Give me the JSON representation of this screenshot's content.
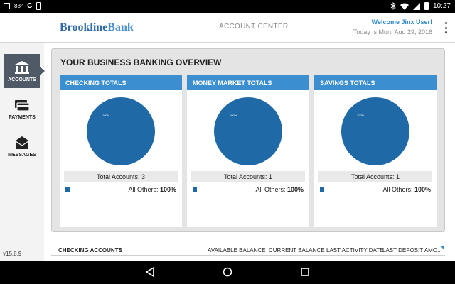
{
  "status_bar": {
    "temperature": "88°",
    "clock": "10:27"
  },
  "header": {
    "logo_part1": "Brookline",
    "logo_part2": "Bank",
    "title": "ACCOUNT CENTER",
    "welcome": "Welcome Jinx User!",
    "date": "Today is Mon, Aug 29, 2016"
  },
  "sidebar": {
    "items": [
      {
        "label": "ACCOUNTS",
        "icon": "bank-icon",
        "active": true
      },
      {
        "label": "PAYMENTS",
        "icon": "card-icon",
        "active": false
      },
      {
        "label": "MESSAGES",
        "icon": "envelope-icon",
        "active": false
      }
    ],
    "version": "v15.8.9"
  },
  "overview": {
    "title": "YOUR BUSINESS BANKING OVERVIEW",
    "cards": [
      {
        "title": "CHECKING TOTALS",
        "total": "Total Accounts: 3",
        "legend_label": "All Others:",
        "legend_value": "100%",
        "pie_label": "100%"
      },
      {
        "title": "MONEY MARKET TOTALS",
        "total": "Total Accounts: 1",
        "legend_label": "All Others:",
        "legend_value": "100%",
        "pie_label": "100%"
      },
      {
        "title": "SAVINGS TOTALS",
        "total": "Total Accounts: 1",
        "legend_label": "All Others:",
        "legend_value": "100%",
        "pie_label": "100%"
      }
    ]
  },
  "table": {
    "section_title": "CHECKING ACCOUNTS",
    "columns": [
      "AVAILABLE BALANCE",
      "CURRENT BALANCE",
      "LAST ACTIVITY DATE",
      "LAST DEPOSIT AMO..."
    ]
  },
  "colors": {
    "accent": "#3b8fd1",
    "pie": "#1f6aa6",
    "sidebar_active": "#4f5a66"
  }
}
